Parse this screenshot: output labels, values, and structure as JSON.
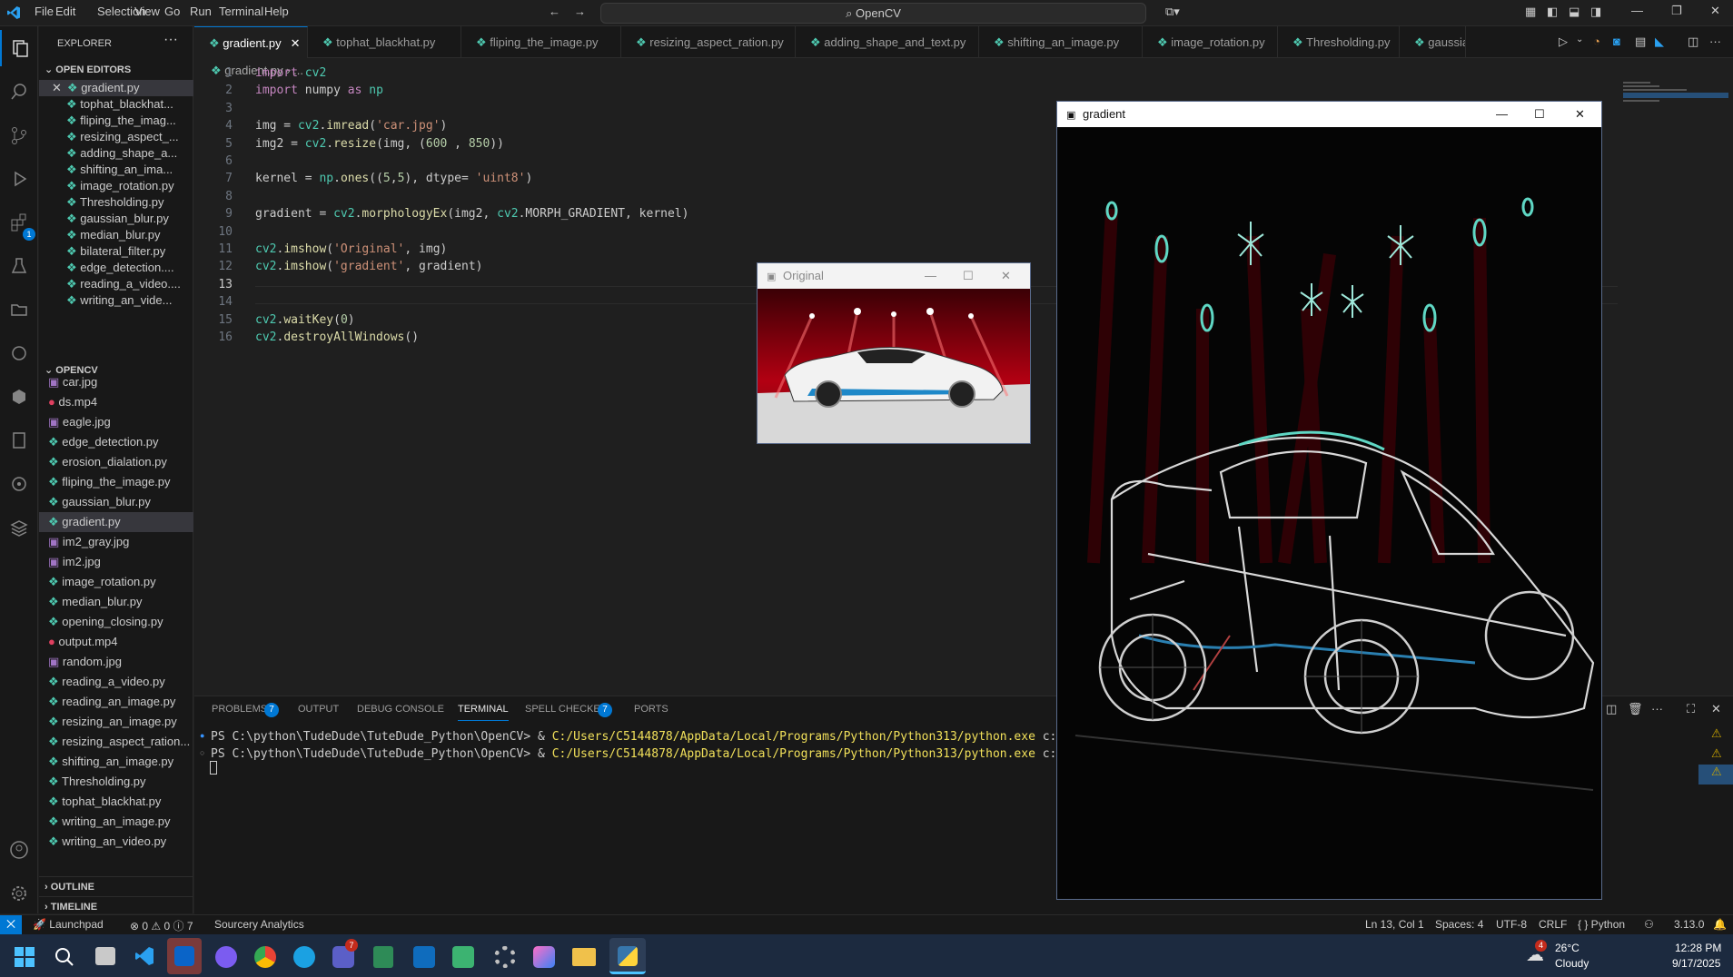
{
  "titlebar": {
    "menu": [
      "File",
      "Edit",
      "Selection",
      "View",
      "Go",
      "Run",
      "Terminal",
      "Help"
    ],
    "search": "OpenCV"
  },
  "sidebar": {
    "title": "EXPLORER",
    "open_editors_header": "OPEN EDITORS",
    "open_editors": [
      "gradient.py",
      "tophat_blackhat...",
      "fliping_the_imag...",
      "resizing_aspect_...",
      "adding_shape_a...",
      "shifting_an_ima...",
      "image_rotation.py",
      "Thresholding.py",
      "gaussian_blur.py",
      "median_blur.py",
      "bilateral_filter.py",
      "edge_detection....",
      "reading_a_video....",
      "writing_an_vide..."
    ],
    "folder_header": "OPENCV",
    "files": [
      "car.jpg",
      "ds.mp4",
      "eagle.jpg",
      "edge_detection.py",
      "erosion_dialation.py",
      "fliping_the_image.py",
      "gaussian_blur.py",
      "gradient.py",
      "im2_gray.jpg",
      "im2.jpg",
      "image_rotation.py",
      "median_blur.py",
      "opening_closing.py",
      "output.mp4",
      "random.jpg",
      "reading_a_video.py",
      "reading_an_image.py",
      "resizing_an_image.py",
      "resizing_aspect_ration...",
      "shifting_an_image.py",
      "Thresholding.py",
      "tophat_blackhat.py",
      "writing_an_image.py",
      "writing_an_video.py"
    ],
    "outline": "OUTLINE",
    "timeline": "TIMELINE"
  },
  "tabs": [
    "gradient.py",
    "tophat_blackhat.py",
    "fliping_the_image.py",
    "resizing_aspect_ration.py",
    "adding_shape_and_text.py",
    "shifting_an_image.py",
    "image_rotation.py",
    "Thresholding.py",
    "gaussian_blur"
  ],
  "breadcrumb": {
    "file": "gradient.py",
    "more": "..."
  },
  "code": [
    {
      "n": "1",
      "t": "import cv2"
    },
    {
      "n": "2",
      "t": "import numpy as np"
    },
    {
      "n": "3",
      "t": ""
    },
    {
      "n": "4",
      "t": "img = cv2.imread('car.jpg')"
    },
    {
      "n": "5",
      "t": "img2 = cv2.resize(img, (600 , 850))"
    },
    {
      "n": "6",
      "t": ""
    },
    {
      "n": "7",
      "t": "kernel = np.ones((5,5), dtype= 'uint8')"
    },
    {
      "n": "8",
      "t": ""
    },
    {
      "n": "9",
      "t": "gradient = cv2.morphologyEx(img2, cv2.MORPH_GRADIENT, kernel)"
    },
    {
      "n": "10",
      "t": ""
    },
    {
      "n": "11",
      "t": "cv2.imshow('Original', img)"
    },
    {
      "n": "12",
      "t": "cv2.imshow('gradient', gradient)"
    },
    {
      "n": "13",
      "t": ""
    },
    {
      "n": "14",
      "t": ""
    },
    {
      "n": "15",
      "t": "cv2.waitKey(0)"
    },
    {
      "n": "16",
      "t": "cv2.destroyAllWindows()"
    }
  ],
  "panel": {
    "tabs": [
      "PROBLEMS",
      "OUTPUT",
      "DEBUG CONSOLE",
      "TERMINAL",
      "SPELL CHECKER",
      "PORTS"
    ],
    "problems_count": "7",
    "spell_count": "7",
    "terminal": [
      {
        "prompt": "PS C:\\python\\TudeDude\\TuteDude_Python\\OpenCV> & ",
        "cmd": "C:/Users/C5144878/AppData/Local/Programs/Python/Python313/python.exe",
        "arg": " c:/python/TudeDu"
      },
      {
        "prompt": "PS C:\\python\\TudeDude\\TuteDude_Python\\OpenCV> & ",
        "cmd": "C:/Users/C5144878/AppData/Local/Programs/Python/Python313/python.exe",
        "arg": " c:/python/TudeDu"
      }
    ]
  },
  "windows": {
    "original": "Original",
    "gradient": "gradient"
  },
  "statusbar": {
    "launchpad": "Launchpad",
    "errors": "0",
    "warnings": "0",
    "info": "7",
    "sourcery": "Sourcery Analytics",
    "position": "Ln 13, Col 1",
    "spaces": "Spaces: 4",
    "encoding": "UTF-8",
    "eol": "CRLF",
    "language": "{ } Python",
    "version": "3.13.0"
  },
  "taskbar": {
    "weather_temp": "26°C",
    "weather_desc": "Cloudy",
    "time": "12:28 PM",
    "date": "9/17/2025",
    "weather_badge": "4",
    "teams_badge": "7"
  },
  "colors": {
    "accent": "#0078d4",
    "keyword": "#c586c0",
    "string": "#ce9178",
    "func": "#dcdcaa"
  }
}
